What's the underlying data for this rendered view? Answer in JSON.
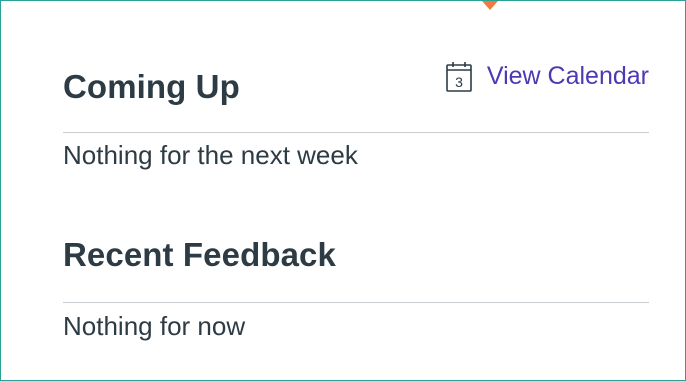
{
  "coming_up": {
    "title": "Coming Up",
    "view_calendar_label": "View Calendar",
    "calendar_icon_day": "3",
    "empty_text": "Nothing for the next week"
  },
  "recent_feedback": {
    "title": "Recent Feedback",
    "empty_text": "Nothing for now"
  },
  "colors": {
    "border": "#2aa197",
    "notch": "#f07b3f",
    "heading": "#2d3b45",
    "link": "#4c3ab3",
    "divider": "#c7cdd1"
  },
  "icons": {
    "calendar": "calendar-icon"
  }
}
